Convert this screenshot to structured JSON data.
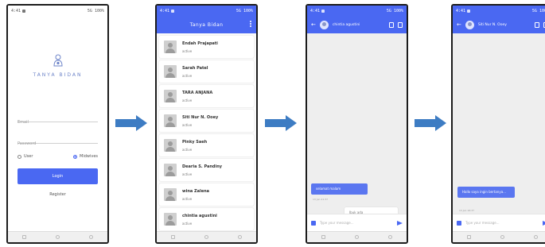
{
  "colors": {
    "primary": "#4a68f2",
    "arrow": "#3d7cc3"
  },
  "status_bar": {
    "left": "4:41",
    "right": "5G 100%"
  },
  "login": {
    "app_name": "TANYA BIDAN",
    "logo_icon": "mother-baby-icon",
    "email_placeholder": "Email",
    "password_placeholder": "Password",
    "role_user": "User",
    "role_midwife": "Midwives",
    "button": "Login",
    "register": "Register"
  },
  "contacts": {
    "title": "Tanya Bidan",
    "items": [
      {
        "name": "Endah Prajapati",
        "status": "active"
      },
      {
        "name": "Sarah Patel",
        "status": "active"
      },
      {
        "name": "TARA ANJANA",
        "status": "active"
      },
      {
        "name": "Siti Nur N. Ooey",
        "status": "active"
      },
      {
        "name": "Pinky Saeh",
        "status": "active"
      },
      {
        "name": "Dearia S. Pandiny",
        "status": "active"
      },
      {
        "name": "wina Zalena",
        "status": "active"
      },
      {
        "name": "chintia agustini",
        "status": "active"
      }
    ]
  },
  "chat1": {
    "title": "chintia agustini",
    "messages": [
      {
        "text": "selamat malam",
        "direction": "in",
        "time": "13 Jun 21:37"
      },
      {
        "text": "Ibuk ada",
        "direction": "out"
      }
    ],
    "input_placeholder": "Type your message..."
  },
  "chat2": {
    "title": "Siti Nur N. Ooey",
    "messages": [
      {
        "text": "Hallo saya ingin bertanya...",
        "direction": "in",
        "time": "13 Jun 16:37"
      }
    ],
    "input_placeholder": "Type your message..."
  }
}
